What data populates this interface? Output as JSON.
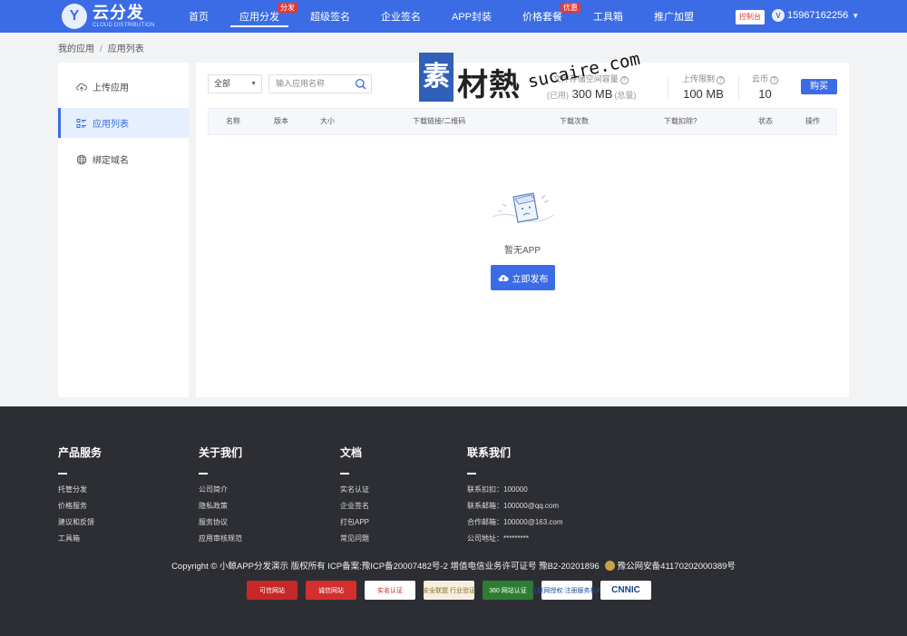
{
  "brand": {
    "logo_letter": "Y",
    "name": "云分发",
    "tagline": "CLOUD DISTRIBUTION"
  },
  "nav": {
    "items": [
      {
        "label": "首页"
      },
      {
        "label": "应用分发",
        "badge": "分发"
      },
      {
        "label": "超级签名"
      },
      {
        "label": "企业签名"
      },
      {
        "label": "APP封装"
      },
      {
        "label": "价格套餐",
        "badge": "优惠"
      },
      {
        "label": "工具箱"
      },
      {
        "label": "推广加盟"
      }
    ],
    "console_label": "控制台",
    "user_avatar_letter": "V",
    "user_phone": "15967162256"
  },
  "breadcrumb": {
    "root": "我的应用",
    "current": "应用列表"
  },
  "sidebar": {
    "items": [
      {
        "label": "上传应用"
      },
      {
        "label": "应用列表"
      },
      {
        "label": "绑定域名"
      }
    ]
  },
  "toolbar": {
    "filter_value": "全部",
    "search_placeholder": "输入应用名称"
  },
  "stats": {
    "storage_label": "文件存储空间容量",
    "storage_used_suffix": "(已用)",
    "storage_total": "300 MB",
    "storage_total_suffix": "(总量)",
    "upload_limit_label": "上传限制",
    "upload_limit_value": "100 MB",
    "coins_label": "云币",
    "coins_value": "10",
    "buy_label": "购买"
  },
  "table": {
    "headers": [
      "名称",
      "版本",
      "大小",
      "下载链接/二维码",
      "下载次数",
      "下载扣除?",
      "状态",
      "操作"
    ]
  },
  "empty": {
    "text": "暂无APP",
    "publish_label": "立即发布"
  },
  "watermark": {
    "box_char": "素",
    "text": "材熱",
    "url": "sucaire.com"
  },
  "footer": {
    "columns": [
      {
        "title": "产品服务",
        "links": [
          "托管分发",
          "价格服务",
          "建议和反馈",
          "工具箱"
        ]
      },
      {
        "title": "关于我们",
        "links": [
          "公司简介",
          "隐私政策",
          "服务协议",
          "应用审核规范"
        ]
      },
      {
        "title": "文档",
        "links": [
          "实名认证",
          "企业签名",
          "打包APP",
          "常见问题"
        ]
      },
      {
        "title": "联系我们",
        "links": [
          "联系扣扣：100000",
          "联系邮箱：100000@qq.com",
          "合作邮箱：100000@163.com",
          "公司地址：*********"
        ]
      }
    ],
    "copyright": "Copyright © 小鲸APP分发演示 版权所有 ICP备案:豫ICP备20007482号-2 增值电信业务许可证号 豫B2-20201896",
    "police_record": "豫公网安备41170202000389号",
    "badges": [
      {
        "label": "可信网站",
        "bg": "#c62828",
        "fg": "#ffffff"
      },
      {
        "label": "诚信网站",
        "bg": "#d32f2f",
        "fg": "#ffffff"
      },
      {
        "label": "实名认证",
        "bg": "#ffffff",
        "fg": "#c62828"
      },
      {
        "label": "安全联盟 行业验证",
        "bg": "#f5efe0",
        "fg": "#8a6d1e"
      },
      {
        "label": "360 网站认证",
        "bg": "#2e7d32",
        "fg": "#ffffff"
      },
      {
        "label": "互联网授权 注册服务机构",
        "bg": "#ffffff",
        "fg": "#1a4f9c"
      },
      {
        "label": "CNNIC",
        "bg": "#ffffff",
        "fg": "#1a3f8c"
      }
    ]
  },
  "colors": {
    "primary": "#3b6ce6",
    "footer_bg": "#2d2e33",
    "badge_red": "#e53935"
  }
}
